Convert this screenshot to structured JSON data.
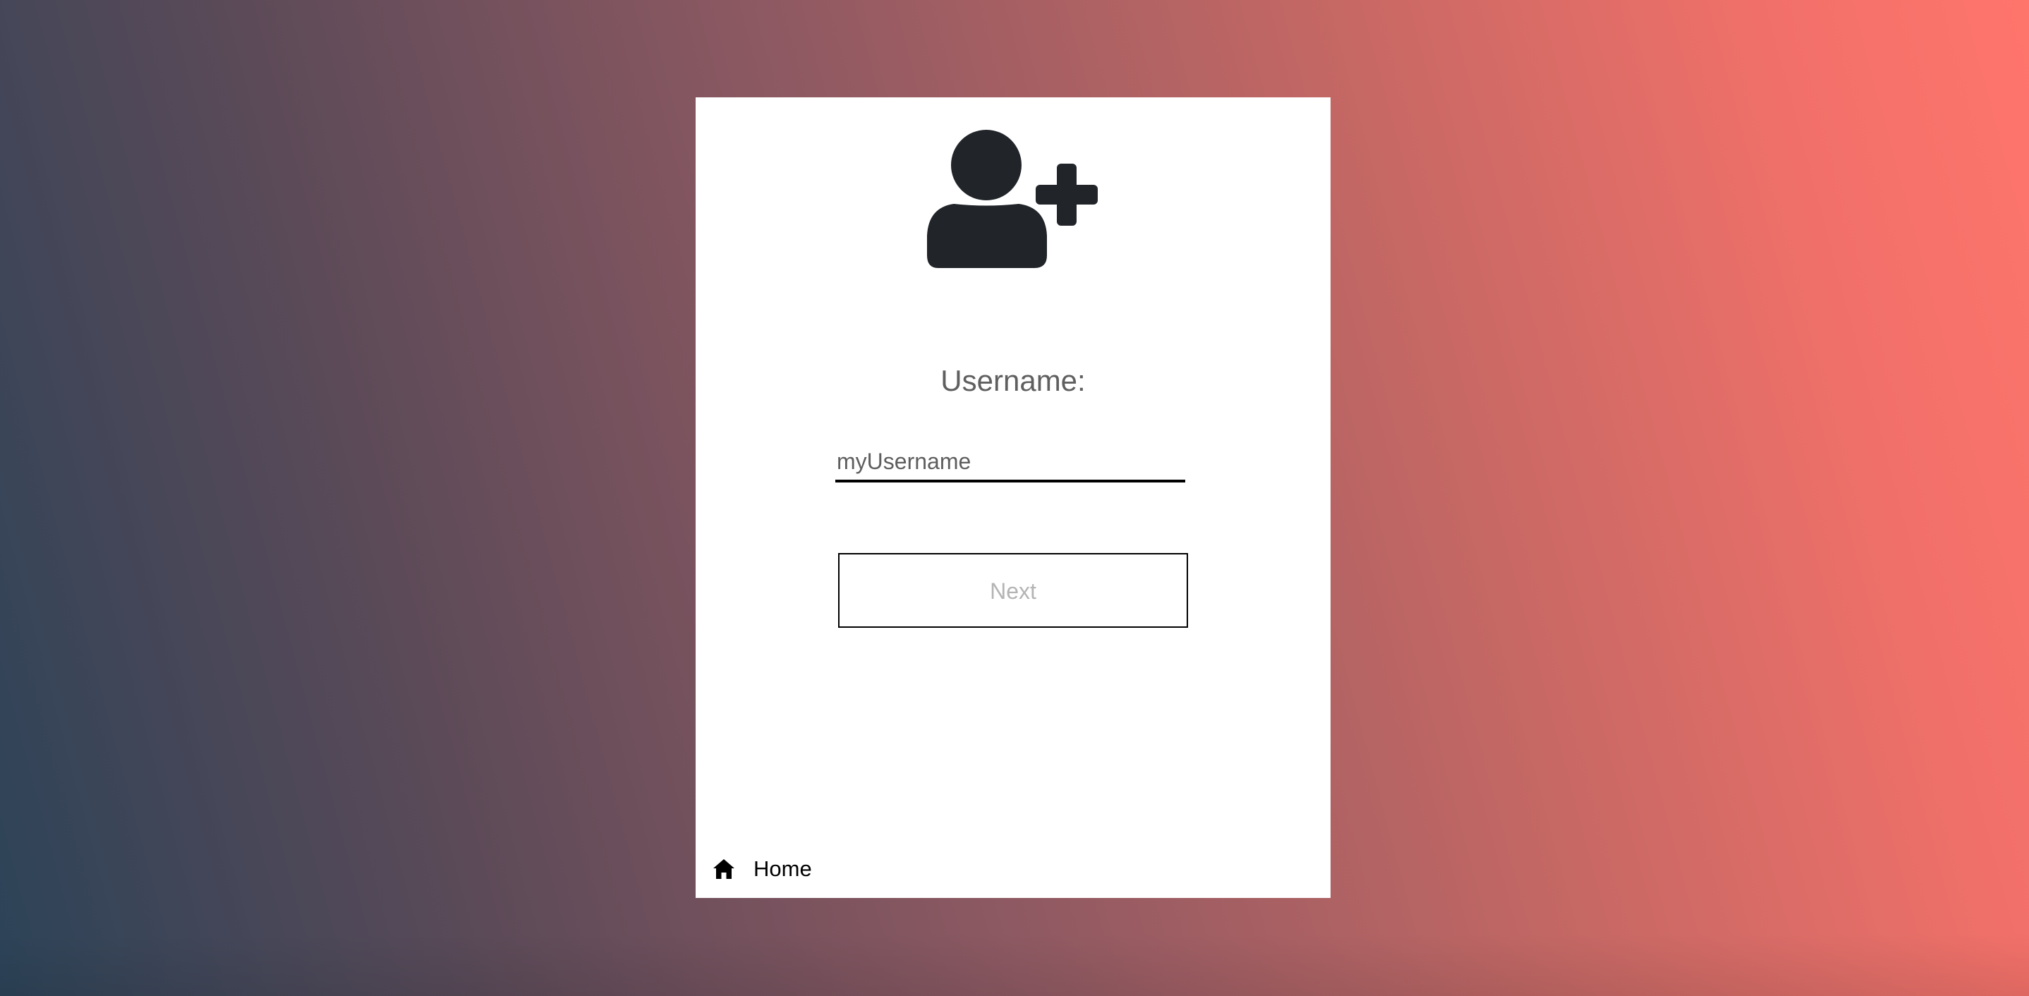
{
  "signup": {
    "icon": "user-plus-icon",
    "label": "Username:",
    "input": {
      "placeholder": "myUsername",
      "value": ""
    },
    "next_label": "Next"
  },
  "footer": {
    "home_icon": "home-icon",
    "home_label": "Home"
  },
  "colors": {
    "gradient_start": "#2c4358",
    "gradient_end": "#ff756c",
    "card": "#ffffff",
    "icon": "#212529",
    "label": "#5f5f5f",
    "button_text_disabled": "#b4b4b4"
  }
}
